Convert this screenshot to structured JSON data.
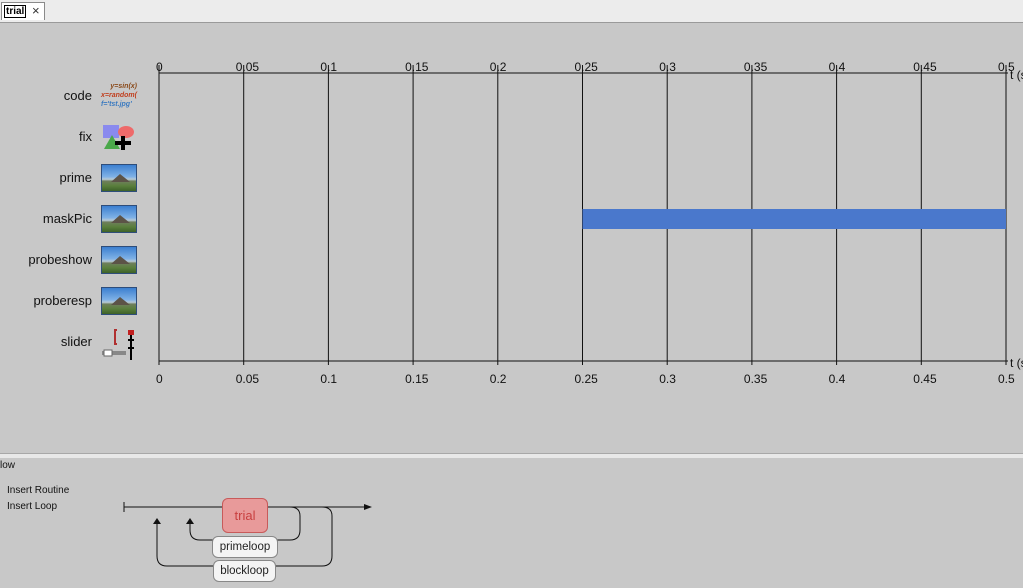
{
  "tab": {
    "title": "trial",
    "close_icon": "×"
  },
  "timeline": {
    "ticks": [
      "0",
      "0.05",
      "0.1",
      "0.15",
      "0.2",
      "0.25",
      "0.3",
      "0.35",
      "0.4",
      "0.45",
      "0.5"
    ],
    "axis_label": "t (s",
    "components": [
      {
        "name": "code",
        "icon": "code-icon"
      },
      {
        "name": "fix",
        "icon": "fixation-icon"
      },
      {
        "name": "prime",
        "icon": "image-icon"
      },
      {
        "name": "maskPic",
        "icon": "image-icon"
      },
      {
        "name": "probeshow",
        "icon": "image-icon"
      },
      {
        "name": "proberesp",
        "icon": "image-icon"
      },
      {
        "name": "slider",
        "icon": "slider-icon"
      }
    ],
    "bars": [
      {
        "component": "maskPic",
        "start": 0.25,
        "stop": 0.5,
        "color": "#4a78cc"
      }
    ],
    "code_icon_lines": [
      "y=sin(x)",
      "x=random(",
      "f='tst.jpg'"
    ]
  },
  "flow": {
    "title": "low",
    "insert_routine": "Insert Routine",
    "insert_loop": "Insert Loop",
    "routine": "trial",
    "loops": [
      "primeloop",
      "blockloop"
    ]
  }
}
